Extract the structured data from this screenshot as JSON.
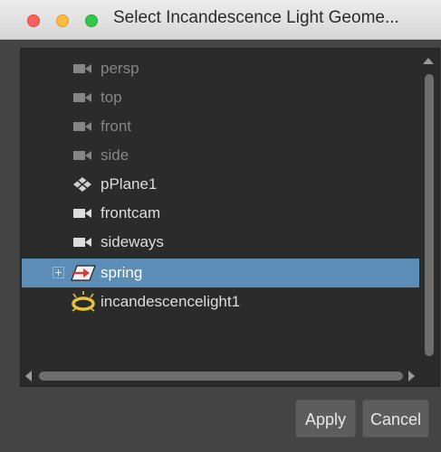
{
  "window": {
    "title": "Select Incandescence Light Geome..."
  },
  "outliner": {
    "items": [
      {
        "label": "persp",
        "icon": "camera-icon",
        "state": "dimmed"
      },
      {
        "label": "top",
        "icon": "camera-icon",
        "state": "dimmed"
      },
      {
        "label": "front",
        "icon": "camera-icon",
        "state": "dimmed"
      },
      {
        "label": "side",
        "icon": "camera-icon",
        "state": "dimmed"
      },
      {
        "label": "pPlane1",
        "icon": "mesh-plane-icon",
        "state": "normal"
      },
      {
        "label": "frontcam",
        "icon": "camera-icon",
        "state": "normal"
      },
      {
        "label": "sideways",
        "icon": "camera-icon",
        "state": "normal"
      },
      {
        "label": "spring",
        "icon": "spring-icon",
        "state": "selected",
        "expandable": true
      },
      {
        "label": "incandescencelight1",
        "icon": "incandescence-light-icon",
        "state": "normal"
      }
    ]
  },
  "buttons": {
    "apply_label": "Apply",
    "cancel_label": "Cancel"
  },
  "colors": {
    "selection": "#5b8db6",
    "panel_bg": "#2b2b2b",
    "window_bg": "#444444",
    "text_normal": "#dddddd",
    "text_dimmed": "#868686",
    "light_icon": "#e6c43a",
    "spring_icon": "#d93a3a"
  }
}
